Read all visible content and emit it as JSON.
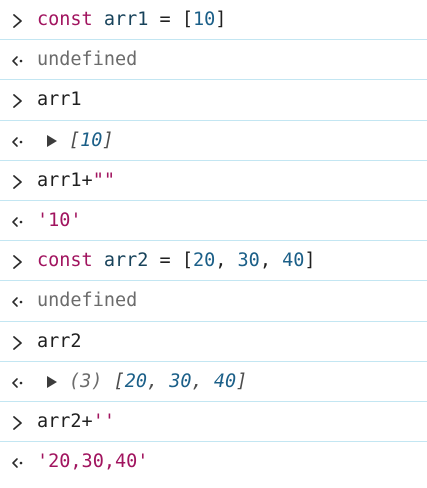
{
  "console": {
    "rows": [
      {
        "kind": "input",
        "tokens": [
          "const",
          " ",
          "arr1",
          " = [",
          "10",
          "]"
        ]
      },
      {
        "kind": "output",
        "text": "undefined"
      },
      {
        "kind": "input",
        "text": "arr1"
      },
      {
        "kind": "output",
        "array_text": [
          "[",
          "10",
          "]"
        ]
      },
      {
        "kind": "input",
        "tokens": [
          "arr1+",
          "\"\""
        ]
      },
      {
        "kind": "output",
        "text": "'10'"
      },
      {
        "kind": "input",
        "tokens": [
          "const",
          " ",
          "arr2",
          " = [",
          "20",
          ", ",
          "30",
          ", ",
          "40",
          "]"
        ]
      },
      {
        "kind": "output",
        "text": "undefined"
      },
      {
        "kind": "input",
        "text": "arr2"
      },
      {
        "kind": "output",
        "array_len": "(3)",
        "array_text": [
          "[",
          "20",
          ", ",
          "30",
          ", ",
          "40",
          "]"
        ]
      },
      {
        "kind": "input",
        "tokens": [
          "arr2+",
          "''"
        ]
      },
      {
        "kind": "output",
        "text": "'20,30,40'"
      }
    ]
  },
  "colors": {
    "keyword": "#a1145f",
    "variable": "#17425a",
    "number": "#1b5f88",
    "string": "#a1145f",
    "undefined": "#6b6b6b",
    "divider": "#c3e6f2"
  },
  "icons": {
    "input_prompt": "chevron-right-icon",
    "output_prompt": "return-arrow-icon",
    "expand": "triangle-right-icon"
  }
}
